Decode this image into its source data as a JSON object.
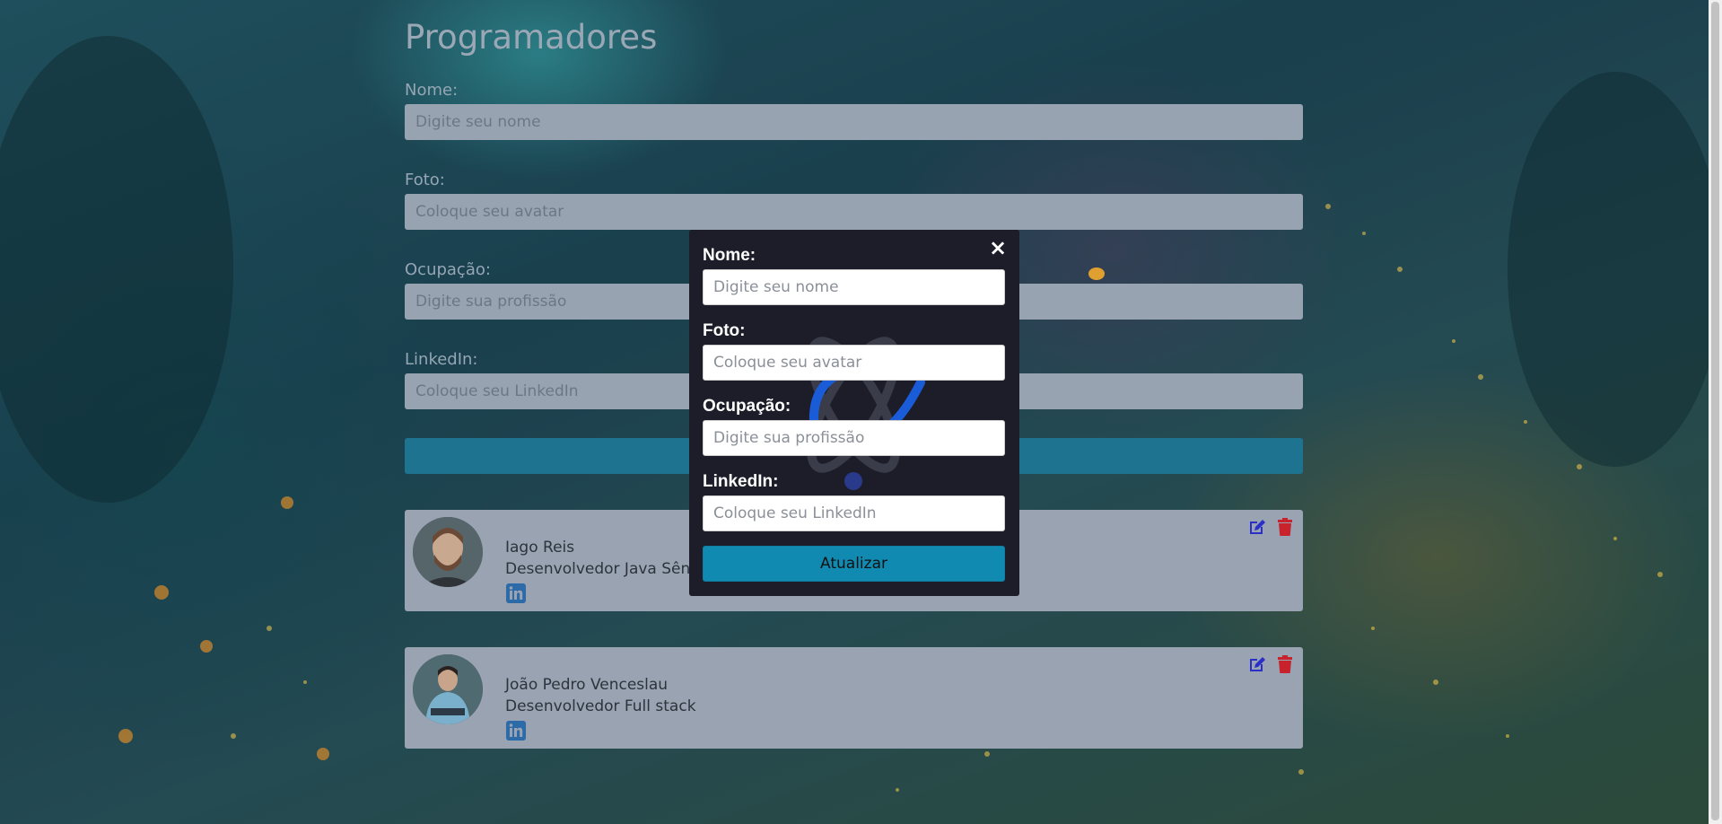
{
  "page": {
    "title": "Programadores"
  },
  "form": {
    "name_label": "Nome:",
    "name_placeholder": "Digite seu nome",
    "photo_label": "Foto:",
    "photo_placeholder": "Coloque seu avatar",
    "occupation_label": "Ocupação:",
    "occupation_placeholder": "Digite sua profissão",
    "linkedin_label": "LinkedIn:",
    "linkedin_placeholder": "Coloque seu LinkedIn"
  },
  "cards": [
    {
      "name": "Iago Reis",
      "role": "Desenvolvedor Java Sênior"
    },
    {
      "name": "João Pedro Venceslau",
      "role": "Desenvolvedor Full stack"
    }
  ],
  "modal": {
    "close_icon": "×",
    "name_label": "Nome:",
    "name_placeholder": "Digite seu nome",
    "photo_label": "Foto:",
    "photo_placeholder": "Coloque seu avatar",
    "occupation_label": "Ocupação:",
    "occupation_placeholder": "Digite sua profissão",
    "linkedin_label": "LinkedIn:",
    "linkedin_placeholder": "Coloque seu LinkedIn",
    "submit_label": "Atualizar"
  },
  "colors": {
    "modal_bg": "#1c1d29",
    "submit_button": "#118ab2",
    "edit_icon": "#2a2fc8",
    "delete_icon": "#c8232c",
    "linkedin_icon": "#2c6aa8"
  }
}
